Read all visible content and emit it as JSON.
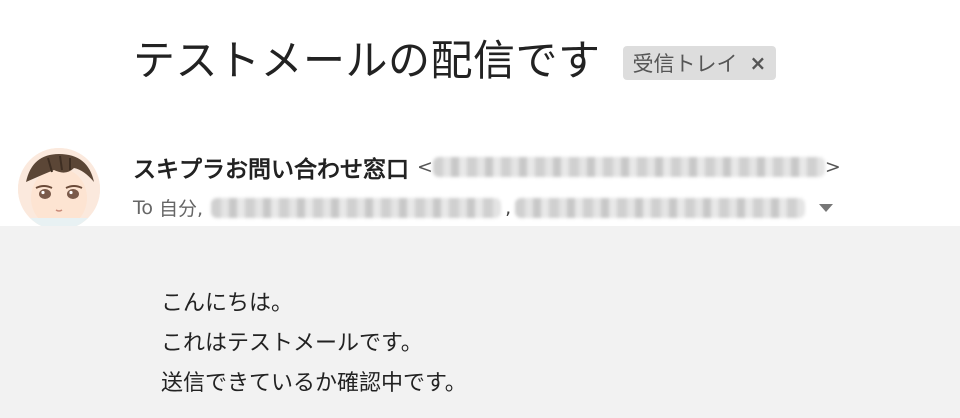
{
  "email": {
    "subject": "テストメールの配信です",
    "label_chip": {
      "text": "受信トレイ",
      "close_glyph": "×"
    },
    "sender": {
      "name": "スキプラお問い合わせ窓口",
      "email_open": "<",
      "email_close": ">",
      "email_redacted": true
    },
    "recipients": {
      "to_prefix": "To",
      "self": "自分,",
      "separator": ",",
      "others_redacted": true
    },
    "body_lines": [
      "こんにちは。",
      "これはテストメールです。",
      "送信できているか確認中です。"
    ]
  },
  "icons": {
    "avatar": "avatar-illustration",
    "chip_close": "close-icon",
    "details_toggle": "chevron-down-icon"
  },
  "colors": {
    "label_chip_bg": "#dddddd",
    "body_bg": "#f2f2f2",
    "text": "#222222"
  }
}
